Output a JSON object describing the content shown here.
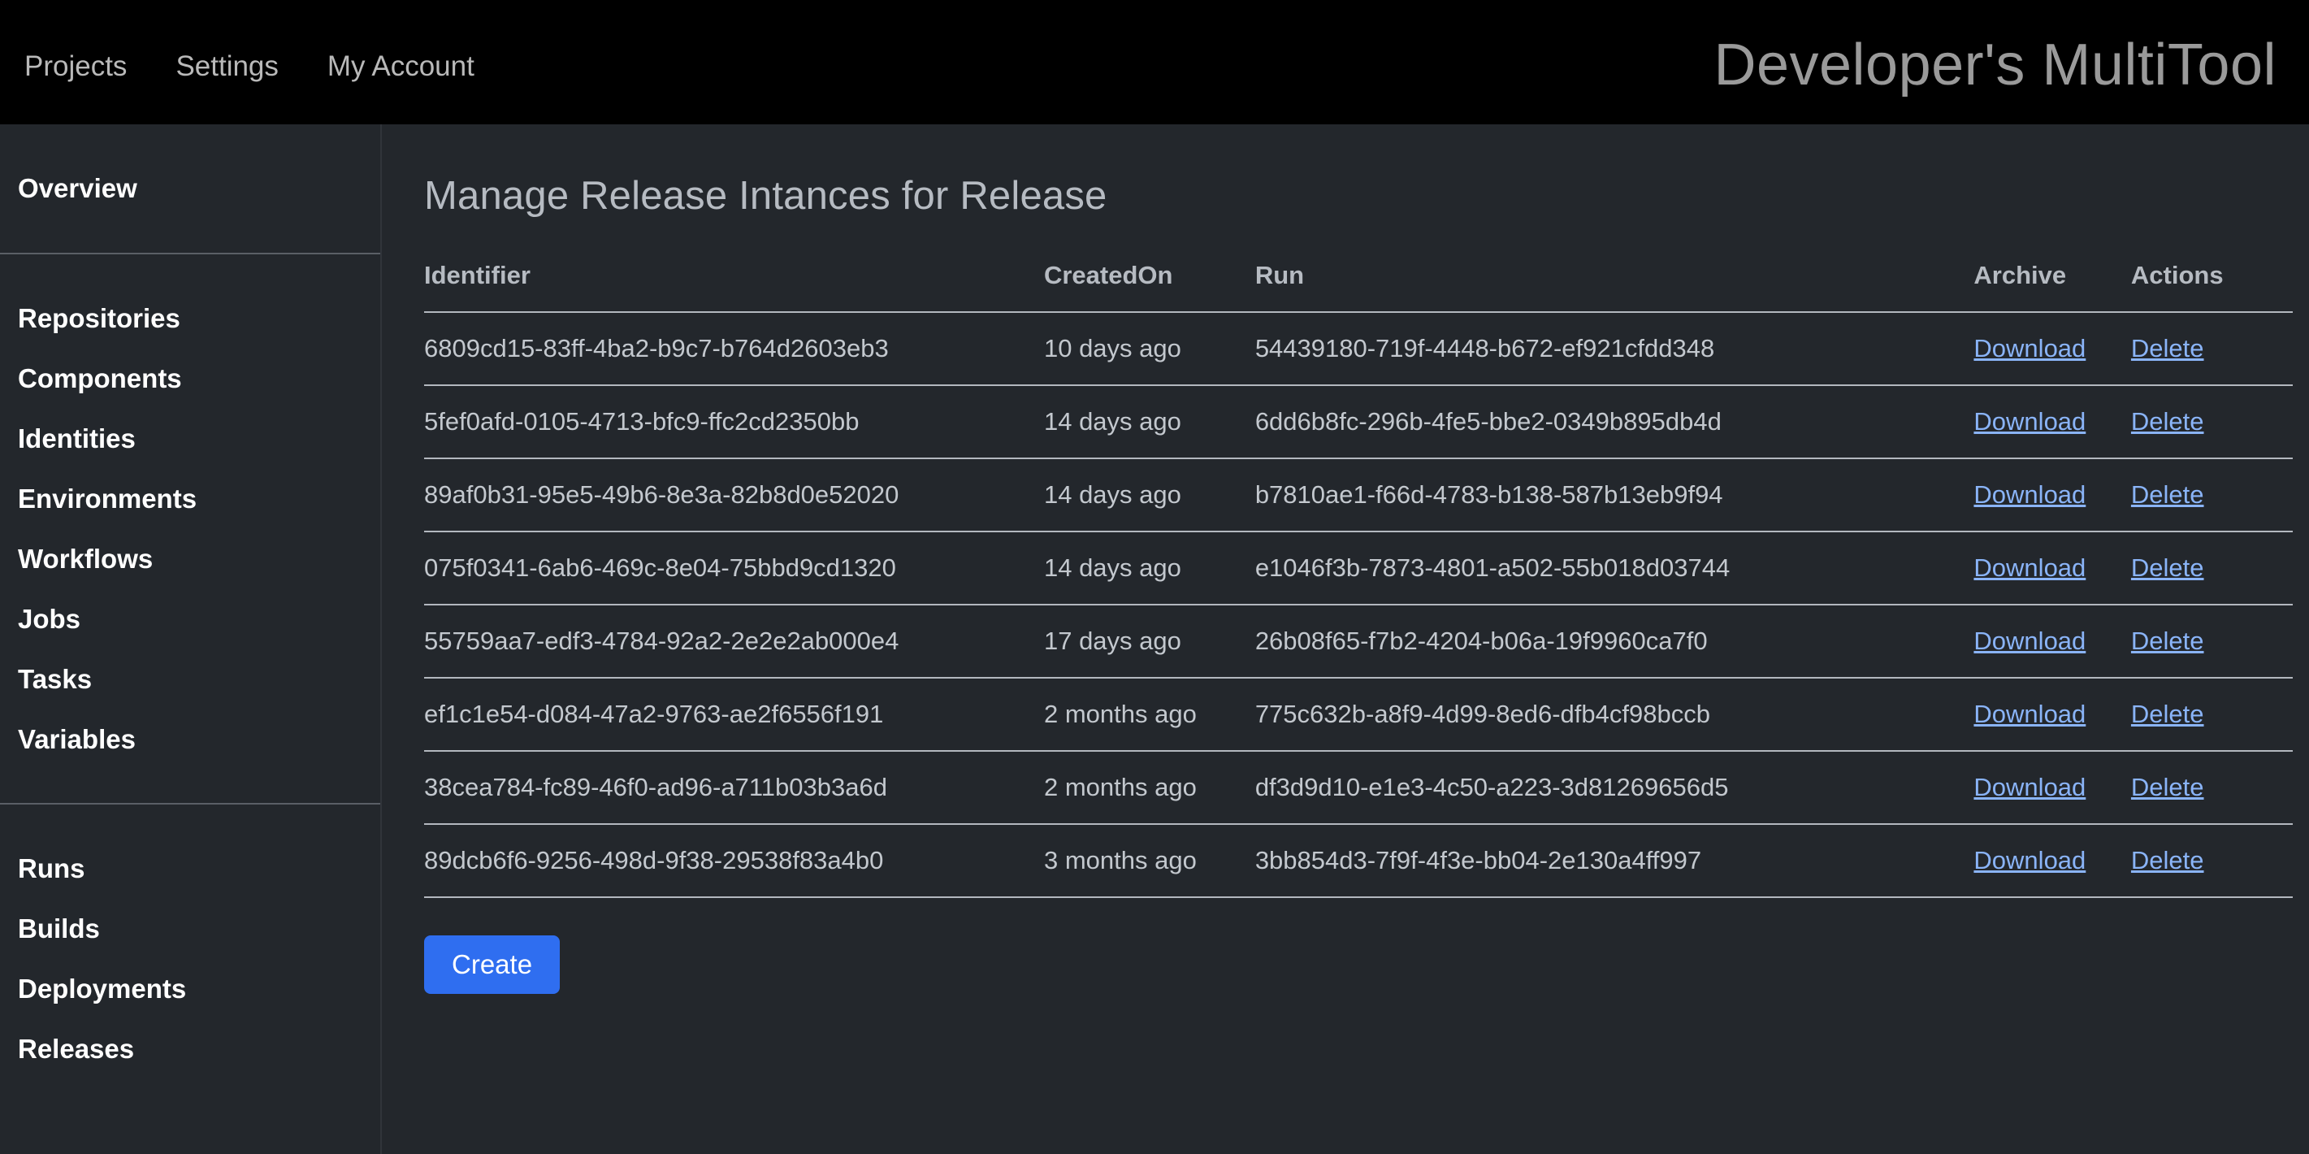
{
  "header": {
    "brand": "Developer's MultiTool",
    "nav": [
      {
        "label": "Projects"
      },
      {
        "label": "Settings"
      },
      {
        "label": "My Account"
      }
    ]
  },
  "sidebar": {
    "groups": [
      {
        "items": [
          {
            "label": "Overview"
          }
        ]
      },
      {
        "items": [
          {
            "label": "Repositories"
          },
          {
            "label": "Components"
          },
          {
            "label": "Identities"
          },
          {
            "label": "Environments"
          },
          {
            "label": "Workflows"
          },
          {
            "label": "Jobs"
          },
          {
            "label": "Tasks"
          },
          {
            "label": "Variables"
          }
        ]
      },
      {
        "items": [
          {
            "label": "Runs"
          },
          {
            "label": "Builds"
          },
          {
            "label": "Deployments"
          },
          {
            "label": "Releases"
          }
        ]
      }
    ]
  },
  "main": {
    "title": "Manage Release Intances for Release",
    "table": {
      "columns": [
        "Identifier",
        "CreatedOn",
        "Run",
        "Archive",
        "Actions"
      ],
      "rows": [
        {
          "identifier": "6809cd15-83ff-4ba2-b9c7-b764d2603eb3",
          "created_on": "10 days ago",
          "run": "54439180-719f-4448-b672-ef921cfdd348",
          "archive": "Download",
          "action": "Delete"
        },
        {
          "identifier": "5fef0afd-0105-4713-bfc9-ffc2cd2350bb",
          "created_on": "14 days ago",
          "run": "6dd6b8fc-296b-4fe5-bbe2-0349b895db4d",
          "archive": "Download",
          "action": "Delete"
        },
        {
          "identifier": "89af0b31-95e5-49b6-8e3a-82b8d0e52020",
          "created_on": "14 days ago",
          "run": "b7810ae1-f66d-4783-b138-587b13eb9f94",
          "archive": "Download",
          "action": "Delete"
        },
        {
          "identifier": "075f0341-6ab6-469c-8e04-75bbd9cd1320",
          "created_on": "14 days ago",
          "run": "e1046f3b-7873-4801-a502-55b018d03744",
          "archive": "Download",
          "action": "Delete"
        },
        {
          "identifier": "55759aa7-edf3-4784-92a2-2e2e2ab000e4",
          "created_on": "17 days ago",
          "run": "26b08f65-f7b2-4204-b06a-19f9960ca7f0",
          "archive": "Download",
          "action": "Delete"
        },
        {
          "identifier": "ef1c1e54-d084-47a2-9763-ae2f6556f191",
          "created_on": "2 months ago",
          "run": "775c632b-a8f9-4d99-8ed6-dfb4cf98bccb",
          "archive": "Download",
          "action": "Delete"
        },
        {
          "identifier": "38cea784-fc89-46f0-ad96-a711b03b3a6d",
          "created_on": "2 months ago",
          "run": "df3d9d10-e1e3-4c50-a223-3d81269656d5",
          "archive": "Download",
          "action": "Delete"
        },
        {
          "identifier": "89dcb6f6-9256-498d-9f38-29538f83a4b0",
          "created_on": "3 months ago",
          "run": "3bb854d3-7f9f-4f3e-bb04-2e130a4ff997",
          "archive": "Download",
          "action": "Delete"
        }
      ]
    },
    "create_button": "Create"
  },
  "colors": {
    "topbar_bg": "#000000",
    "page_bg": "#23272c",
    "link": "#8ab4f8",
    "primary_button": "#2f6ef0",
    "rule": "#b3b8bf"
  }
}
